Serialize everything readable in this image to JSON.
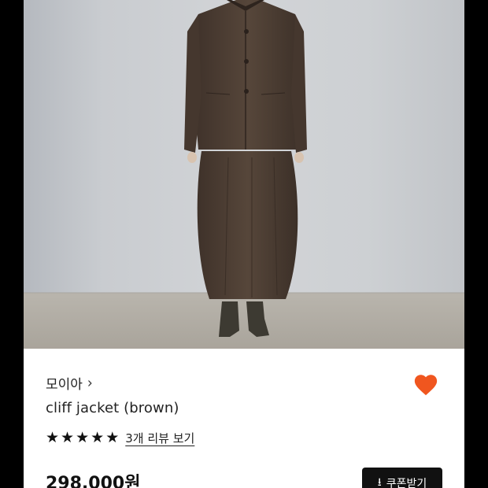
{
  "product": {
    "brand": "모이아",
    "brand_chevron": "›",
    "name": "cliff jacket (brown)",
    "rating_stars": 5,
    "review_link": "3개 리뷰 보기",
    "price": "298,000원",
    "coupon_label": "쿠폰받기",
    "liked": true
  },
  "icons": {
    "heart": "heart-icon",
    "download": "download-icon",
    "star": "star-icon",
    "chevron": "chevron-right-icon"
  },
  "colors": {
    "heart": "#f0561f",
    "coupon_bg": "#111111",
    "outfit": "#4e3e32"
  }
}
